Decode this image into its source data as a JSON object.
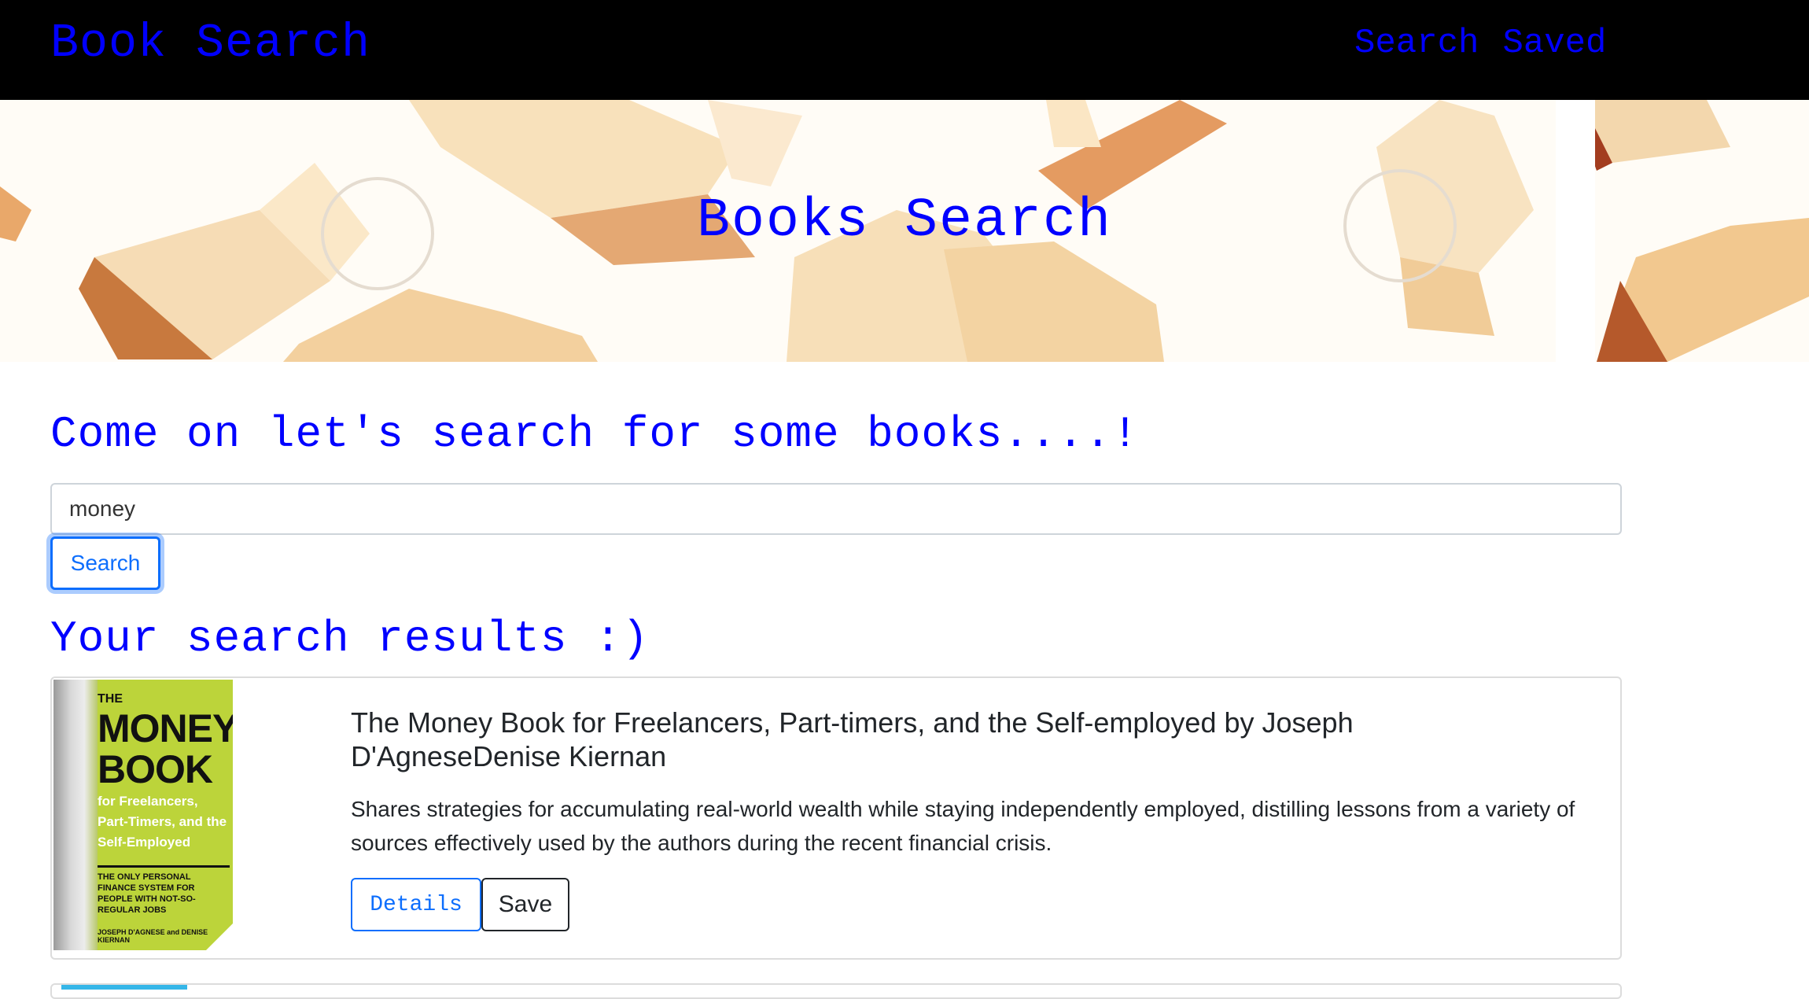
{
  "navbar": {
    "brand": "Book Search",
    "links": [
      "Search",
      "Saved"
    ]
  },
  "hero": {
    "title": "Books Search"
  },
  "search": {
    "heading": "Come on let's search for some books....!",
    "query": "money",
    "button_label": "Search"
  },
  "results": {
    "heading": "Your search results :)",
    "items": [
      {
        "title": "The Money Book for Freelancers, Part-timers, and the Self-employed by Joseph D'AgneseDenise Kiernan",
        "description": "Shares strategies for accumulating real-world wealth while staying independently employed, distilling lessons from a variety of sources effectively used by the authors during the recent financial crisis.",
        "details_label": "Details",
        "save_label": "Save",
        "cover": {
          "the": "THE",
          "title": "MONEY BOOK",
          "subtitle": "for Freelancers, Part-Timers, and the Self-Employed",
          "tagline": "THE ONLY PERSONAL FINANCE SYSTEM FOR PEOPLE WITH NOT-SO-REGULAR JOBS",
          "authors": "JOSEPH D'AGNESE and DENISE KIERNAN"
        }
      }
    ]
  },
  "colors": {
    "navbar_bg": "#000000",
    "accent_text": "#0000ff",
    "button_primary": "#0d6efd",
    "cover_bg": "#bcd43a"
  }
}
